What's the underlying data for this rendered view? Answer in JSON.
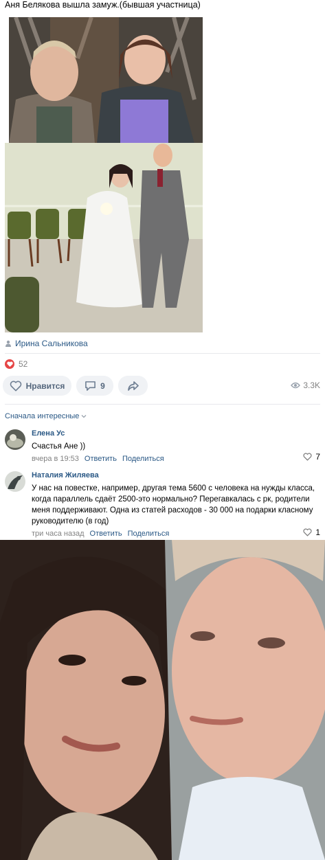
{
  "post": {
    "title": "Аня Белякова вышла замуж.(бывшая участница)",
    "author": "Ирина Сальникова",
    "likes_count": "52",
    "like_label": "Нравится",
    "comments_count": "9",
    "views": "3.3K"
  },
  "comments": {
    "sort_label": "Сначала интересные",
    "items": [
      {
        "name": "Елена Ус",
        "text": "Счастья Ане ))",
        "time": "вчера в 19:53",
        "reply": "Ответить",
        "share": "Поделиться",
        "likes": "7"
      },
      {
        "name": "Наталия Жиляева",
        "text": "У нас на повестке, например, другая тема 5600 с человека на нужды класса, когда параллель сдаёт 2500-это нормально? Перегавкалась с рк, родители меня поддерживают. Одна из статей расходов - 30 000 на подарки класному руководителю (в год)",
        "time": "три часа назад",
        "reply": "Ответить",
        "share": "Поделиться",
        "likes": "1"
      }
    ]
  },
  "colors": {
    "link": "#2a5885",
    "muted": "#828282",
    "button_bg": "#f0f2f5",
    "heart": "#e64646"
  },
  "icons": [
    "user-icon",
    "heart-icon",
    "comment-icon",
    "share-icon",
    "eye-icon",
    "chevron-down-icon"
  ]
}
